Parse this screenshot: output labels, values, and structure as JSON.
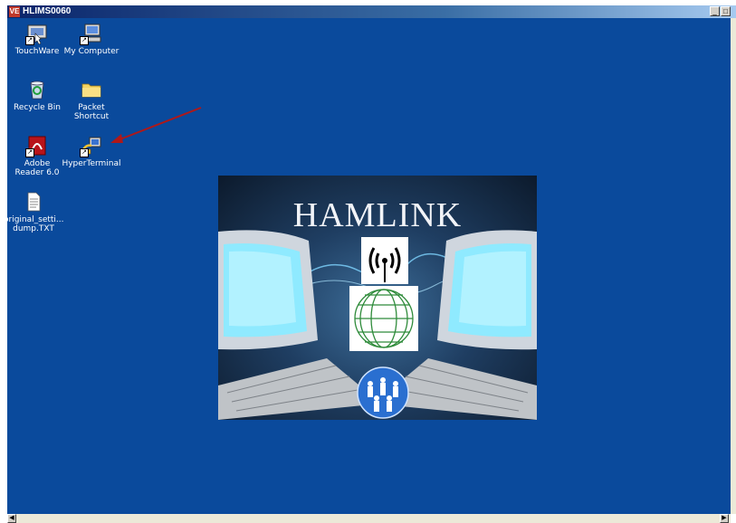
{
  "window": {
    "title": "HLIMS0060",
    "app_icon_text": "VE",
    "minimize_glyph": "_",
    "restore_glyph": "□"
  },
  "desktop": {
    "background": "#0a4a9c",
    "icons": [
      {
        "label": "TouchWare",
        "icon": "touchware-icon",
        "shortcut": true
      },
      {
        "label": "My Computer",
        "icon": "computer-icon",
        "shortcut": true
      },
      {
        "label": "Recycle Bin",
        "icon": "recycle-bin-icon",
        "shortcut": false
      },
      {
        "label": "Packet Shortcut",
        "icon": "folder-icon",
        "shortcut": false
      },
      {
        "label": "Adobe Reader 6.0",
        "icon": "adobe-reader-icon",
        "shortcut": true
      },
      {
        "label": "HyperTerminal",
        "icon": "hyperterminal-icon",
        "shortcut": true
      },
      {
        "label": "original_setti... dump.TXT",
        "icon": "text-file-icon",
        "shortcut": false
      }
    ],
    "annotation": {
      "icon": "red-arrow-icon",
      "color": "#b01818"
    }
  },
  "splash": {
    "title": "HAMLINK"
  },
  "scrollbar": {
    "left_glyph": "◀",
    "right_glyph": "▶"
  }
}
